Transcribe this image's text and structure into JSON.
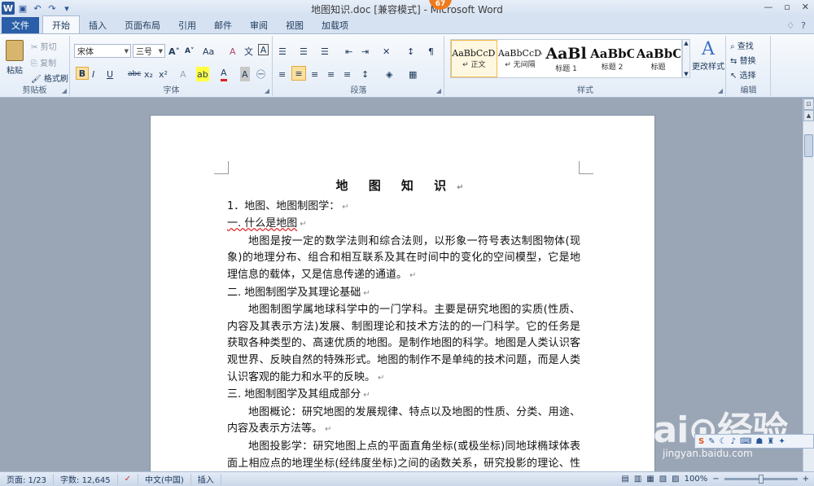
{
  "window": {
    "title": "地图知识.doc [兼容模式] - Microsoft Word",
    "badge": "67",
    "controls": [
      "—",
      "▫",
      "✕"
    ]
  },
  "qat": {
    "icons": [
      "word-icon",
      "save-icon",
      "undo-icon",
      "redo-icon",
      "customize-icon"
    ],
    "logo_letter": "W",
    "save_glyph": "▣",
    "undo_glyph": "↶",
    "redo_glyph": "↷",
    "customize_glyph": "▾"
  },
  "tabs": {
    "file": "文件",
    "items": [
      "开始",
      "插入",
      "页面布局",
      "引用",
      "邮件",
      "审阅",
      "视图",
      "加载项"
    ],
    "active": "开始",
    "right_glyphs": [
      "♢",
      "?",
      "▾"
    ]
  },
  "ribbon": {
    "clipboard": {
      "label": "剪贴板",
      "paste": "粘贴",
      "cut": "剪切",
      "copy": "复制",
      "format_painter": "格式刷"
    },
    "font": {
      "label": "字体",
      "font_name": "宋体",
      "font_size": "三号",
      "grow": "A˄",
      "shrink": "A˅",
      "change_case": "Aa",
      "clear_format": "A",
      "pinyin": "文",
      "border_char": "A",
      "bold": "B",
      "italic": "I",
      "underline": "U",
      "strike": "abc",
      "subscript": "x₂",
      "superscript": "x²",
      "text_effect": "A",
      "highlight": "ab",
      "font_color": "A",
      "char_shading": "A",
      "enclose": "㊀"
    },
    "paragraph": {
      "label": "段落",
      "bullets": "☰",
      "numbering": "☰",
      "multilevel": "☰",
      "decrease_indent": "⇤",
      "increase_indent": "⇥",
      "chinese_layout": "✕",
      "sort": "↕",
      "show_marks": "¶",
      "align_left": "≡",
      "align_center": "≡",
      "align_right": "≡",
      "justify": "≡",
      "distributed": "≡",
      "line_spacing": "↕",
      "shading": "◈",
      "borders": "▦"
    },
    "styles": {
      "label": "样式",
      "items": [
        {
          "preview": "AaBbCcDc",
          "name": "↵ 正文"
        },
        {
          "preview": "AaBbCcDc",
          "name": "↵ 无间隔"
        },
        {
          "preview": "AaBl",
          "name": "标题 1"
        },
        {
          "preview": "AaBbC",
          "name": "标题 2"
        },
        {
          "preview": "AaBbC",
          "name": "标题"
        }
      ],
      "change_styles": "更改样式",
      "change_styles_glyph": "A"
    },
    "editing": {
      "label": "编辑",
      "find": "查找",
      "replace": "替换",
      "select": "选择",
      "find_glyph": "⌕",
      "replace_glyph": "⇆",
      "select_glyph": "↖"
    }
  },
  "document": {
    "title": "地 图 知 识",
    "paragraphs": [
      {
        "text": "1．地图、地图制图学：",
        "indent": false
      },
      {
        "text": "一. 什么是地图",
        "indent": false
      },
      {
        "text": "地图是按一定的数学法则和综合法则，以形象一符号表达制图物体(现象)的地理分布、组合和相互联系及其在时间中的变化的空间模型，它是地理信息的载体，又是信息传递的通道。",
        "indent": true
      },
      {
        "text": "二. 地图制图学及其理论基础",
        "indent": false
      },
      {
        "text": "地图制图学属地球科学中的一门学科。主要是研究地图的实质(性质、内容及其表示方法)发展、制图理论和技术方法的的一门科学。它的任务是获取各种类型的、高速优质的地图。是制作地图的科学。地图是人类认识客观世界、反映自然的特殊形式。地图的制作不是单纯的技术问题，而是人类认识客观的能力和水平的反映。",
        "indent": true
      },
      {
        "text": "三. 地图制图学及其组成部分",
        "indent": false
      },
      {
        "text": "地图概论：研究地图的发展规律、特点以及地图的性质、分类、用途、内容及表示方法等。",
        "indent": true
      },
      {
        "text": "地图投影学：研究地图上点的平面直角坐标(或极坐标)同地球椭球体表面上相应点的地理坐标(经纬度坐标)之间的函数关系，研究投影的理论、性质、变形规律、计算方法机影的判别和选择，以及在编",
        "indent": true
      }
    ],
    "para_mark": "↵"
  },
  "watermark": {
    "logo": "Bai⊙经验",
    "url": "jingyan.baidu.com"
  },
  "toolstrip": {
    "icons": [
      "s-icon",
      "pen-icon",
      "moon-icon",
      "mic-icon",
      "keyboard-icon",
      "skin-icon",
      "shirt-icon",
      "wrench-icon"
    ],
    "glyphs": [
      "S",
      "✎",
      "☾",
      "♪",
      "⌨",
      "☗",
      "♜",
      "✦"
    ]
  },
  "status": {
    "page": "页面: 1/23",
    "words": "字数: 12,645",
    "proof_glyph": "✓",
    "language": "中文(中国)",
    "insert_mode": "插入",
    "zoom": "100%",
    "zoom_minus": "−",
    "zoom_plus": "+",
    "view_glyphs": [
      "▤",
      "▥",
      "▦",
      "▧",
      "▨"
    ],
    "zoom_fraction": 0.5
  }
}
